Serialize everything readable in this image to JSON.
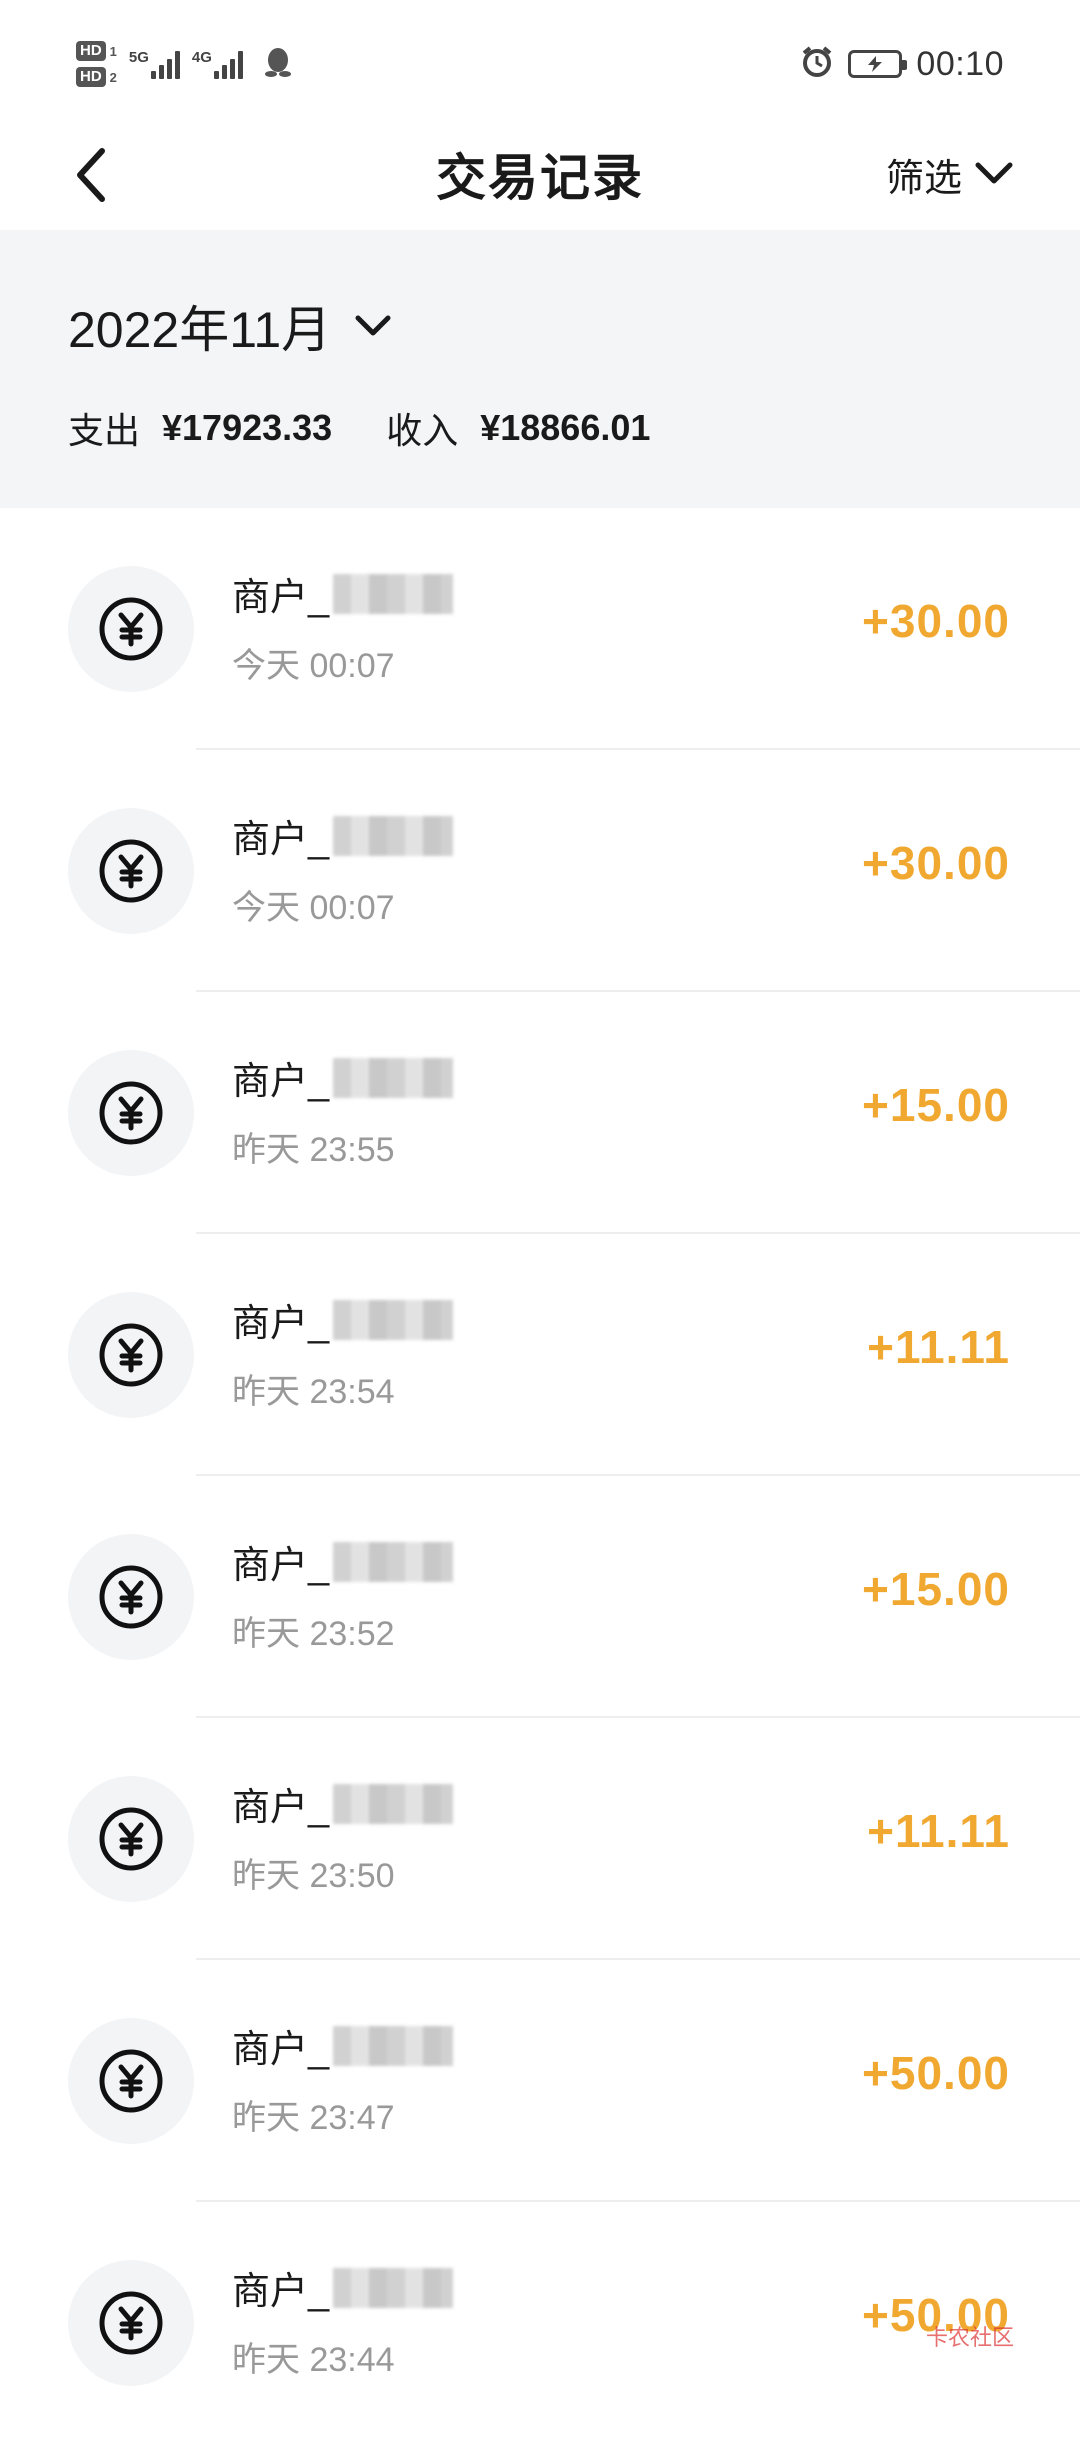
{
  "status_bar": {
    "hd1": "HD",
    "hd1_num": "1",
    "hd2": "HD",
    "hd2_num": "2",
    "net1": "5G",
    "net2": "4G",
    "time": "00:10",
    "icons": [
      "signal-icon",
      "qq-icon",
      "alarm-icon",
      "battery-icon"
    ]
  },
  "nav": {
    "title": "交易记录",
    "filter_label": "筛选"
  },
  "summary": {
    "month": "2022年11月",
    "expense_label": "支出",
    "expense_value": "¥17923.33",
    "income_label": "收入",
    "income_value": "¥18866.01"
  },
  "transactions": [
    {
      "merchant": "商户_",
      "time": "今天 00:07",
      "amount": "+30.00"
    },
    {
      "merchant": "商户_",
      "time": "今天 00:07",
      "amount": "+30.00"
    },
    {
      "merchant": "商户_",
      "time": "昨天 23:55",
      "amount": "+15.00"
    },
    {
      "merchant": "商户_",
      "time": "昨天 23:54",
      "amount": "+11.11"
    },
    {
      "merchant": "商户_",
      "time": "昨天 23:52",
      "amount": "+15.00"
    },
    {
      "merchant": "商户_",
      "time": "昨天 23:50",
      "amount": "+11.11"
    },
    {
      "merchant": "商户_",
      "time": "昨天 23:47",
      "amount": "+50.00"
    },
    {
      "merchant": "商户_",
      "time": "昨天 23:44",
      "amount": "+50.00"
    }
  ],
  "colors": {
    "accent": "#f0a830",
    "summary_bg": "#f4f5f7",
    "secondary_text": "#999999"
  },
  "watermark": "卡农社区"
}
